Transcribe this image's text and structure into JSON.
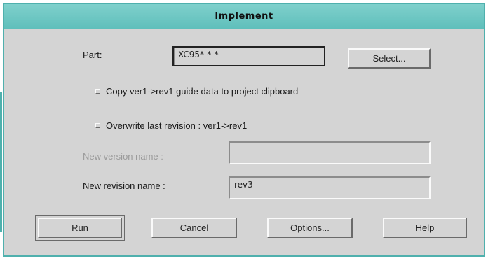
{
  "window": {
    "title": "Implement"
  },
  "part": {
    "label": "Part:",
    "value": "XC95*-*-*",
    "select_label": "Select..."
  },
  "options": {
    "copy_guide": {
      "label": "Copy ver1->rev1 guide data to project clipboard",
      "checked": false
    },
    "overwrite_last": {
      "label": "Overwrite last revision : ver1->rev1",
      "checked": false
    }
  },
  "new_version": {
    "label": "New version name :",
    "value": "",
    "enabled": false
  },
  "new_revision": {
    "label": "New revision name :",
    "value": "rev3"
  },
  "buttons": {
    "run": "Run",
    "cancel": "Cancel",
    "options": "Options...",
    "help": "Help"
  }
}
